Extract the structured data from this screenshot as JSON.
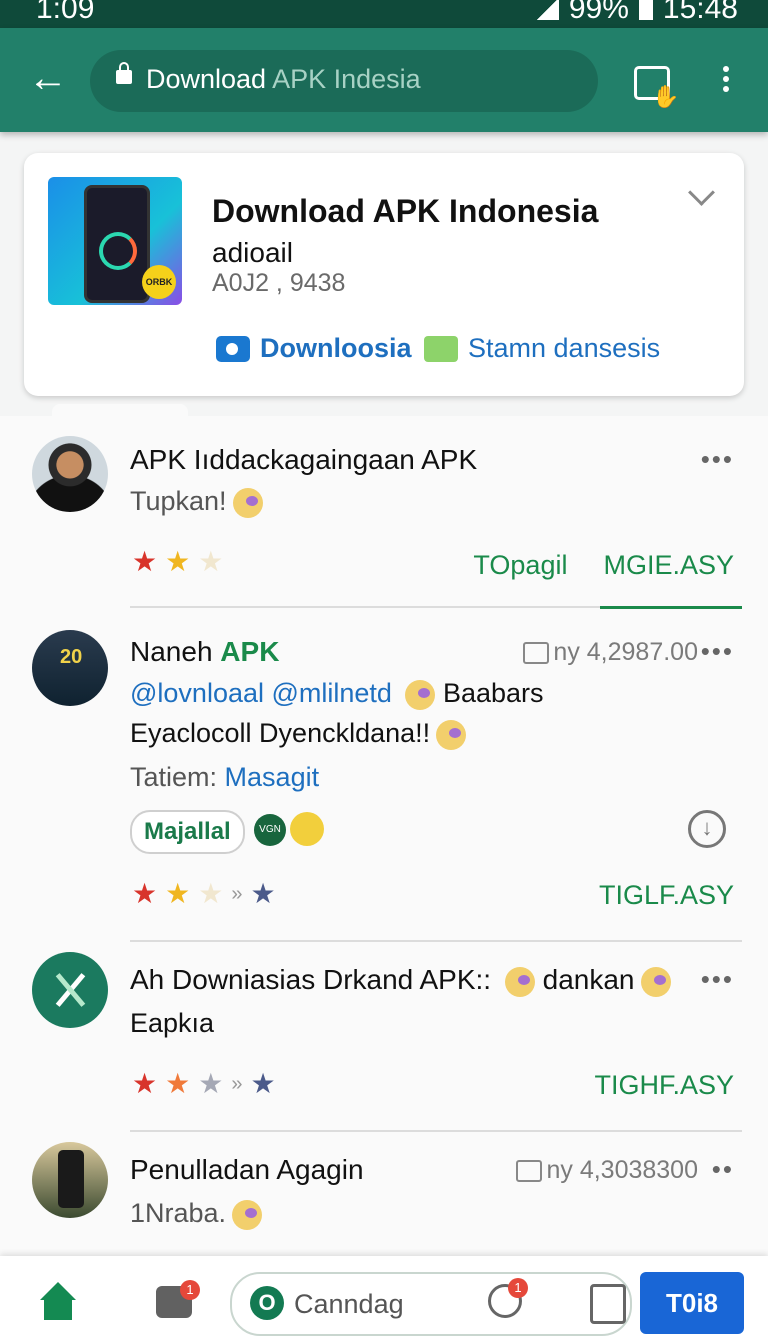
{
  "status_bar": {
    "time": "1:09",
    "battery": "99%",
    "clock": "15:48"
  },
  "toolbar": {
    "url_bold": "Download",
    "url_rest": "APK Indesia"
  },
  "app_card": {
    "title": "Download APK Indonesia",
    "subtitle": "adioail",
    "meta": "A0J2 , 9438",
    "badge_text": "ORBK",
    "action_primary": "Downloosia",
    "action_secondary": "Stamn dansesis"
  },
  "posts": [
    {
      "title": "APK Iıddackagaingaan APK",
      "body": "Tupkan!",
      "more": "•••",
      "tags": [
        "TOpagil",
        "MGIE.ASY"
      ]
    },
    {
      "title_plain": "Naneh",
      "title_accent": "APK",
      "meta": "ny 4,2987.00",
      "more": "•••",
      "line1_link": "@lovnloaal @mlilnetd",
      "line1_text": "Baabars",
      "line2": "Eyaclocoll Dyenckldana!!",
      "line3_label": "Tatiem:",
      "line3_link": "Masagit",
      "chip": "Majallal",
      "chip_badge": "VGN",
      "tag": "TIGLF.ASY"
    },
    {
      "title": "Ah Downiasias Drkand APK::",
      "title_suffix": "dankan",
      "body": "Eapkıa",
      "more": "•••",
      "tag": "TIGHF.ASY"
    },
    {
      "title": "Penulladan Agagin",
      "meta": "ny 4,3038300",
      "more": "••",
      "body": "1Nraba."
    }
  ],
  "bottom_nav": {
    "search_placeholder": "Canndag",
    "button_label": "T0i8",
    "camera_badge": "1",
    "chat_badge": "1"
  },
  "icons": {
    "back": "arrow-left-icon",
    "lock": "lock-icon",
    "bag": "shopping-bag-icon",
    "menu": "more-vert-icon",
    "expand": "chevron-down-icon",
    "download": "download-icon",
    "home": "home-icon",
    "camera": "camera-icon",
    "chat": "chat-icon",
    "clipboard": "clipboard-icon",
    "star": "star-icon"
  },
  "colors": {
    "toolbar": "#22806a",
    "status_bar": "#0f4a3a",
    "accent_green": "#1a8a4a",
    "link_blue": "#1e6fbf",
    "primary_button": "#1966d6",
    "badge_red": "#e5483a"
  }
}
